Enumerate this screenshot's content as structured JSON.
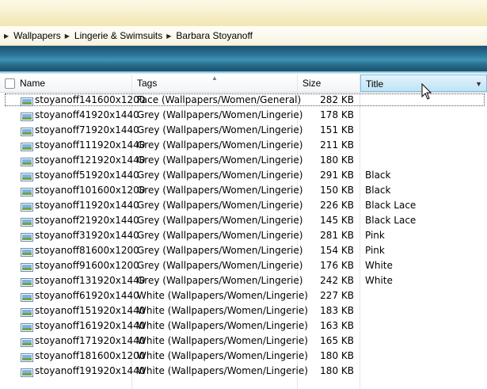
{
  "breadcrumb": [
    "Wallpapers",
    "Lingerie & Swimsuits",
    "Barbara Stoyanoff"
  ],
  "columns": {
    "name": "Name",
    "tags": "Tags",
    "size": "Size",
    "title": "Title"
  },
  "files": [
    {
      "name": "stoyanoff141600x1200",
      "tags": "Face (Wallpapers/Women/General)",
      "size": "282 KB",
      "title": ""
    },
    {
      "name": "stoyanoff41920x1440",
      "tags": "Grey (Wallpapers/Women/Lingerie)",
      "size": "178 KB",
      "title": ""
    },
    {
      "name": "stoyanoff71920x1440",
      "tags": "Grey (Wallpapers/Women/Lingerie)",
      "size": "151 KB",
      "title": ""
    },
    {
      "name": "stoyanoff111920x1440",
      "tags": "Grey (Wallpapers/Women/Lingerie)",
      "size": "211 KB",
      "title": ""
    },
    {
      "name": "stoyanoff121920x1440",
      "tags": "Grey (Wallpapers/Women/Lingerie)",
      "size": "180 KB",
      "title": ""
    },
    {
      "name": "stoyanoff51920x1440",
      "tags": "Grey (Wallpapers/Women/Lingerie)",
      "size": "291 KB",
      "title": "Black"
    },
    {
      "name": "stoyanoff101600x1200",
      "tags": "Grey (Wallpapers/Women/Lingerie)",
      "size": "150 KB",
      "title": "Black"
    },
    {
      "name": "stoyanoff11920x1440",
      "tags": "Grey (Wallpapers/Women/Lingerie)",
      "size": "226 KB",
      "title": "Black Lace"
    },
    {
      "name": "stoyanoff21920x1440",
      "tags": "Grey (Wallpapers/Women/Lingerie)",
      "size": "145 KB",
      "title": "Black Lace"
    },
    {
      "name": "stoyanoff31920x1440",
      "tags": "Grey (Wallpapers/Women/Lingerie)",
      "size": "281 KB",
      "title": "Pink"
    },
    {
      "name": "stoyanoff81600x1200",
      "tags": "Grey (Wallpapers/Women/Lingerie)",
      "size": "154 KB",
      "title": "Pink"
    },
    {
      "name": "stoyanoff91600x1200",
      "tags": "Grey (Wallpapers/Women/Lingerie)",
      "size": "176 KB",
      "title": "White"
    },
    {
      "name": "stoyanoff131920x1440",
      "tags": "Grey (Wallpapers/Women/Lingerie)",
      "size": "242 KB",
      "title": "White"
    },
    {
      "name": "stoyanoff61920x1440",
      "tags": "White (Wallpapers/Women/Lingerie)",
      "size": "227 KB",
      "title": ""
    },
    {
      "name": "stoyanoff151920x1440",
      "tags": "White (Wallpapers/Women/Lingerie)",
      "size": "183 KB",
      "title": ""
    },
    {
      "name": "stoyanoff161920x1440",
      "tags": "White (Wallpapers/Women/Lingerie)",
      "size": "163 KB",
      "title": ""
    },
    {
      "name": "stoyanoff171920x1440",
      "tags": "White (Wallpapers/Women/Lingerie)",
      "size": "165 KB",
      "title": ""
    },
    {
      "name": "stoyanoff181600x1200",
      "tags": "White (Wallpapers/Women/Lingerie)",
      "size": "180 KB",
      "title": ""
    },
    {
      "name": "stoyanoff191920x1440",
      "tags": "White (Wallpapers/Women/Lingerie)",
      "size": "180 KB",
      "title": ""
    }
  ],
  "icons": {
    "breadcrumb_separator": "chevron-right-icon",
    "file": "image-file-icon",
    "sort": "sort-ascending-icon",
    "dropdown": "chevron-down-icon"
  },
  "colors": {
    "toolbar_blue": "#2d7a9c",
    "active_column": "#bfe3f5",
    "title_strip": "#f1e6b4"
  }
}
